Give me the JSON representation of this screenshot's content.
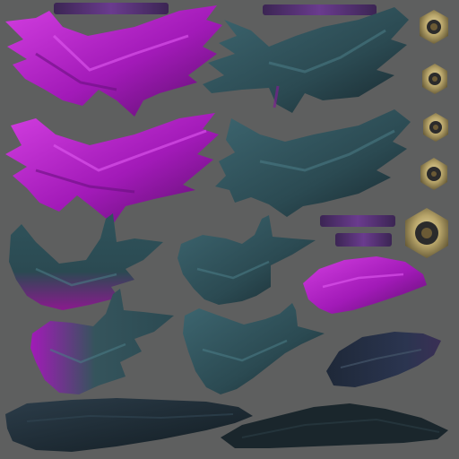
{
  "atlas": {
    "background": "#5e5f5f",
    "palette": {
      "magenta": "#a21ab8",
      "magenta_light": "#d23ee0",
      "magenta_dark": "#5a0f6a",
      "teal": "#2b4a52",
      "teal_light": "#3d6670",
      "teal_dark": "#18282e",
      "gold": "#b8a56a",
      "gold_dark": "#5e5332",
      "bar": "#3b2553",
      "bar_light": "#6a3b8e"
    },
    "assets": [
      "magenta-wing-upper",
      "teal-wing-upper",
      "magenta-wing-middle",
      "teal-wing-middle",
      "teal-wing-curled-left",
      "teal-wing-curled-right",
      "magenta-gradient-wing-left",
      "teal-gradient-wing-right",
      "magenta-small-wing",
      "dark-small-wing",
      "dark-long-feather-left",
      "dark-long-feather-right",
      "gold-hex-gems",
      "purple-bars"
    ]
  }
}
